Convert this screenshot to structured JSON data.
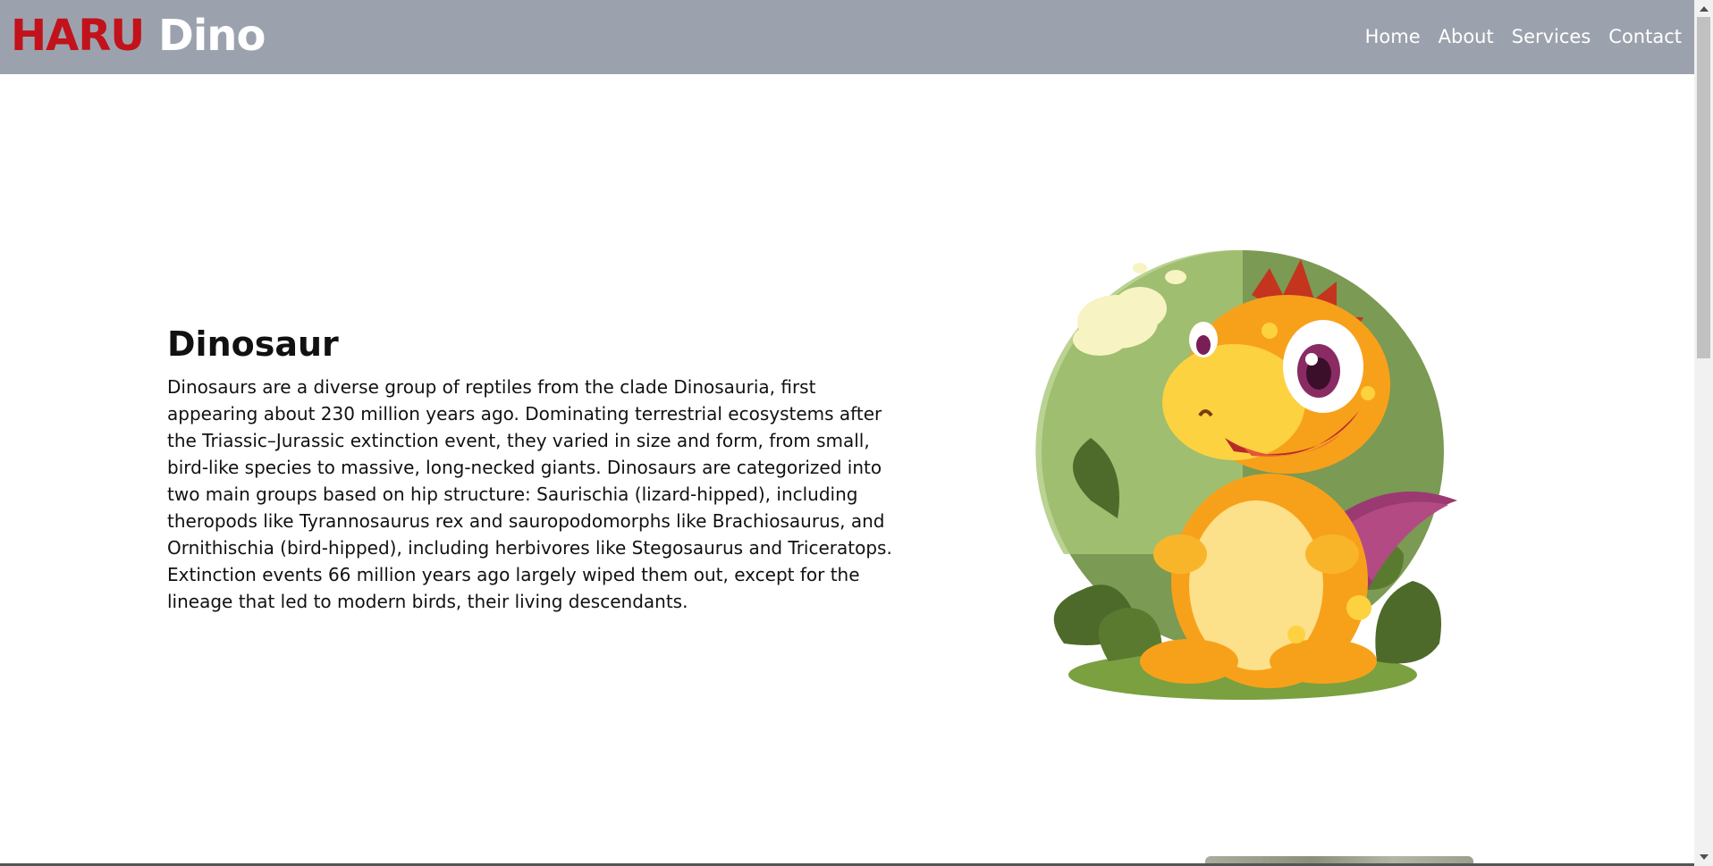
{
  "navbar": {
    "brand_part1": "HARU",
    "brand_part2": "Dino",
    "links": [
      "Home",
      "About",
      "Services",
      "Contact"
    ]
  },
  "main": {
    "title": "Dinosaur",
    "description": "Dinosaurs are a diverse group of reptiles from the clade Dinosauria, first appearing about 230 million years ago. Dominating terrestrial ecosystems after the Triassic–Jurassic extinction event, they varied in size and form, from small, bird-like species to massive, long-necked giants. Dinosaurs are categorized into two main groups based on hip structure: Saurischia (lizard-hipped), including theropods like Tyrannosaurus rex and sauropodomorphs like Brachiosaurus, and Ornithischia (bird-hipped), including herbivores like Stegosaurus and Triceratops. Extinction events 66 million years ago largely wiped them out, except for the lineage that led to modern birds, their living descendants."
  },
  "colors": {
    "navbar_bg": "#9ca2ad",
    "brand_red": "#c2121b",
    "brand_white": "#ffffff"
  },
  "icons": {
    "hero_image": "cartoon-dinosaur-illustration"
  }
}
